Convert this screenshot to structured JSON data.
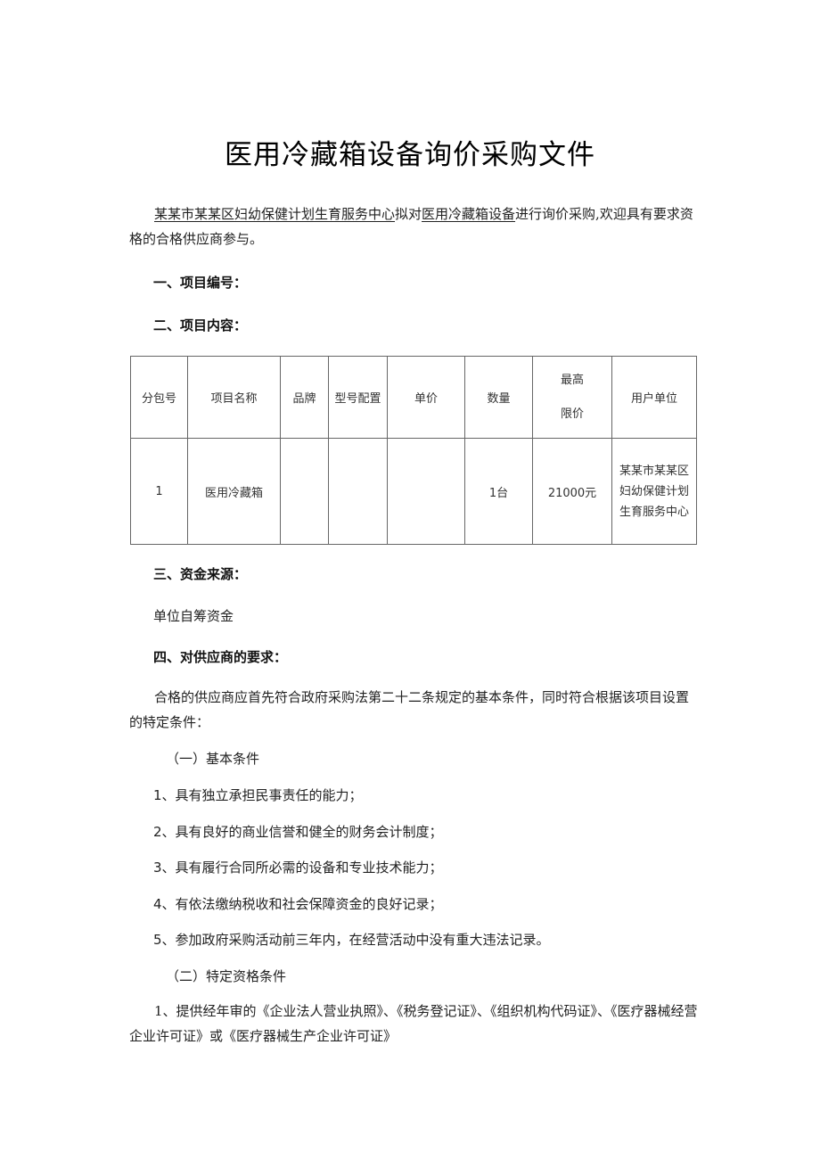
{
  "document": {
    "title": "医用冷藏箱设备询价采购文件",
    "intro": {
      "purchaser": "某某市某某区妇幼保健计划生育服务中心",
      "connector": "拟对",
      "item": "医用冷藏箱设备",
      "rest": "进行询价采购,欢迎具有要求资格的合格供应商参与。"
    },
    "sections": {
      "s1_heading": "一、项目编号：",
      "s2_heading": "二、项目内容：",
      "s3_heading": "三、资金来源：",
      "s3_body": "单位自筹资金",
      "s4_heading": "四、对供应商的要求：",
      "s4_body": "合格的供应商应首先符合政府采购法第二十二条规定的基本条件，同时符合根据该项目设置的特定条件：",
      "basic_heading": "（一）基本条件",
      "basic_items": [
        "1、具有独立承担民事责任的能力；",
        "2、具有良好的商业信誉和健全的财务会计制度；",
        "3、具有履行合同所必需的设备和专业技术能力；",
        "4、有依法缴纳税收和社会保障资金的良好记录；",
        "5、参加政府采购活动前三年内，在经营活动中没有重大违法记录。"
      ],
      "special_heading": "（二）特定资格条件",
      "special_items": [
        "1、提供经年审的《企业法人营业执照》、《税务登记证》、《组织机构代码证》、《医疗器械经营企业许可证》或《医疗器械生产企业许可证》"
      ]
    },
    "table": {
      "headers": [
        "分包号",
        "项目名称",
        "品牌",
        "型号配置",
        "单价",
        "数量",
        "最高",
        "限价",
        "用户单位"
      ],
      "rows": [
        {
          "package_no": "1",
          "name": "医用冷藏箱",
          "brand": "",
          "model": "",
          "unit_price": "",
          "quantity": "1台",
          "max_price": "21000元",
          "user_unit": "某某市某某区妇幼保健计划生育服务中心"
        }
      ]
    }
  }
}
